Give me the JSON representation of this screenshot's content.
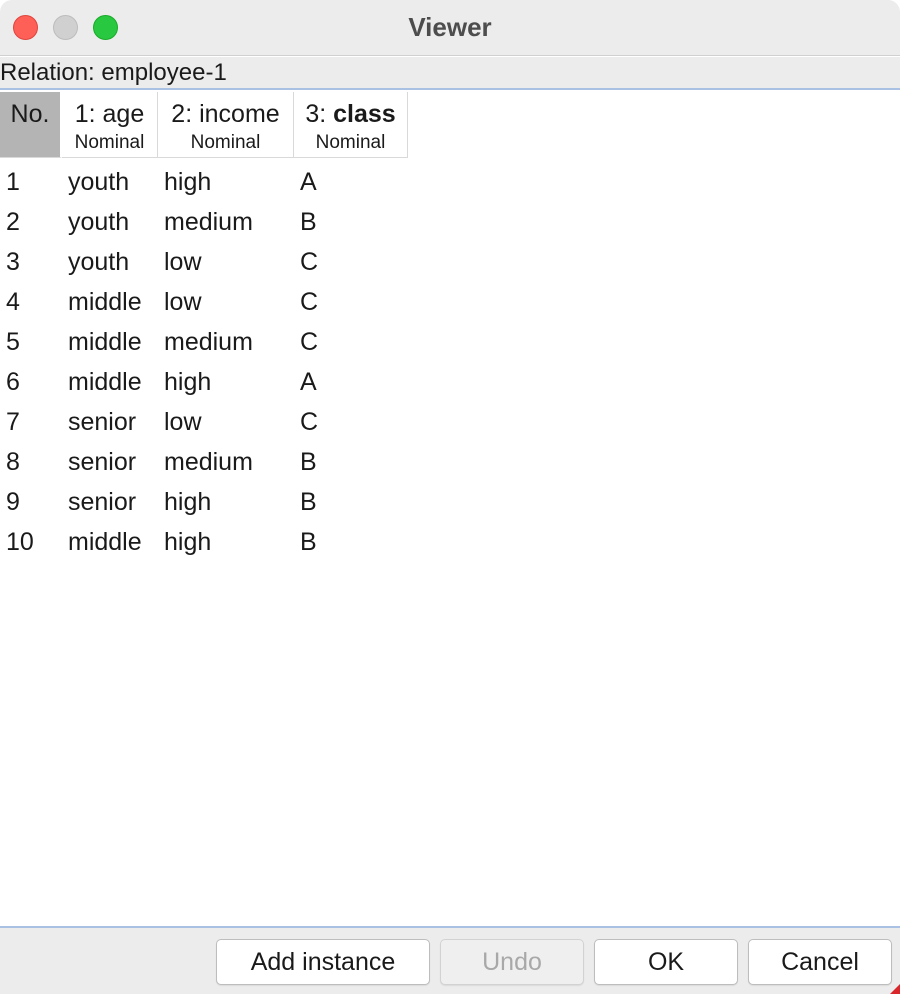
{
  "window": {
    "title": "Viewer"
  },
  "relation": {
    "label": "Relation: employee-1"
  },
  "table": {
    "columns": [
      {
        "name": "No.",
        "type": ""
      },
      {
        "name_prefix": "1: ",
        "name": "age",
        "type": "Nominal"
      },
      {
        "name_prefix": "2: ",
        "name": "income",
        "type": "Nominal"
      },
      {
        "name_prefix": "3: ",
        "name": "class",
        "type": "Nominal"
      }
    ],
    "rows": [
      [
        "1",
        "youth",
        "high",
        "A"
      ],
      [
        "2",
        "youth",
        "medium",
        "B"
      ],
      [
        "3",
        "youth",
        "low",
        "C"
      ],
      [
        "4",
        "middle",
        "low",
        "C"
      ],
      [
        "5",
        "middle",
        "medium",
        "C"
      ],
      [
        "6",
        "middle",
        "high",
        "A"
      ],
      [
        "7",
        "senior",
        "low",
        "C"
      ],
      [
        "8",
        "senior",
        "medium",
        "B"
      ],
      [
        "9",
        "senior",
        "high",
        "B"
      ],
      [
        "10",
        "middle",
        "high",
        "B"
      ]
    ]
  },
  "buttons": {
    "add_instance": "Add instance",
    "undo": "Undo",
    "ok": "OK",
    "cancel": "Cancel"
  },
  "colors": {
    "close": "#fe5f57",
    "minimize": "#d0d0d0",
    "zoom": "#28c840",
    "header_selected": "#b4b4b4",
    "separator_accent": "#a9c2e4"
  }
}
